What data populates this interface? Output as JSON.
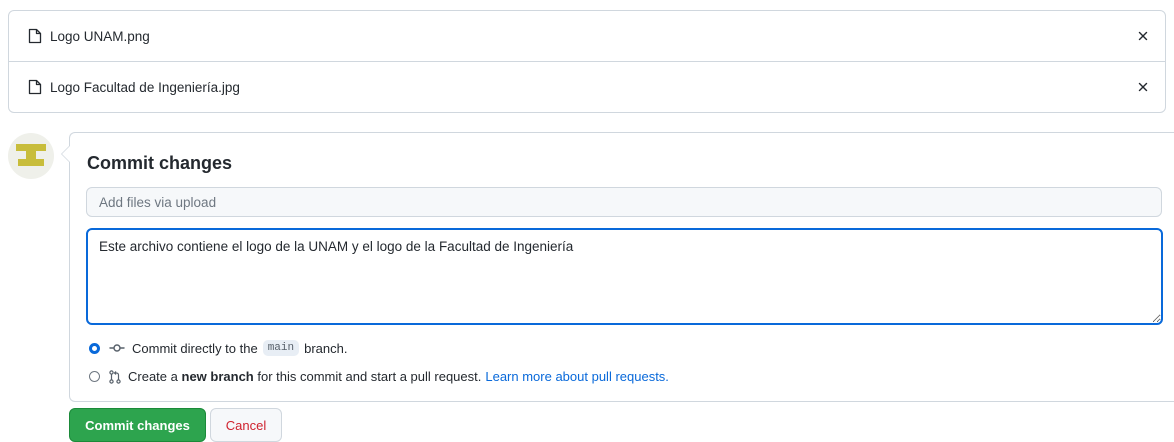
{
  "files": [
    {
      "name": "Logo UNAM.png",
      "icon": "file-icon",
      "remove_icon": "close-icon"
    },
    {
      "name": "Logo Facultad de Ingeniería.jpg",
      "icon": "file-icon",
      "remove_icon": "close-icon"
    }
  ],
  "remove_symbol": "×",
  "commit": {
    "title": "Commit changes",
    "summary_placeholder": "Add files via upload",
    "summary_value": "",
    "description_value": "Este archivo contiene el logo de la UNAM y el logo de la Facultad de Ingeniería"
  },
  "options": {
    "direct": {
      "selected": true,
      "icon": "git-commit-icon",
      "text_before": "Commit directly to the",
      "branch": "main",
      "text_after": "branch."
    },
    "new_branch": {
      "selected": false,
      "icon": "git-pull-request-icon",
      "text_before": "Create a",
      "bold": "new branch",
      "text_after": "for this commit and start a pull request.",
      "link": "Learn more about pull requests."
    }
  },
  "buttons": {
    "commit_label": "Commit changes",
    "cancel_label": "Cancel"
  },
  "colors": {
    "accent": "#0969da",
    "primary_button": "#2da44e",
    "danger_text": "#cf222e",
    "avatar": "#c8bd3b"
  }
}
